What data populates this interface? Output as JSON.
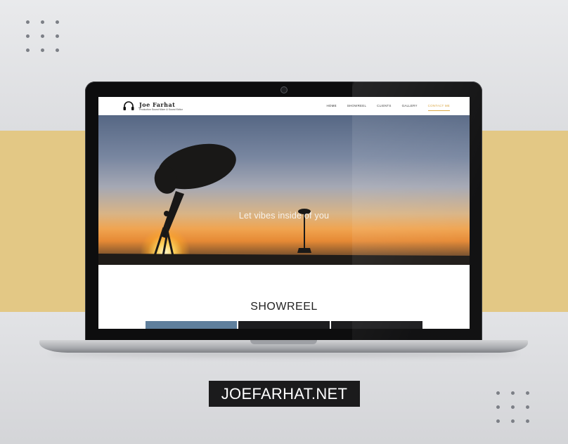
{
  "site": {
    "logo": {
      "name": "Joe Farhat",
      "subtitle": "Production Sound Mixer & Sound Editor"
    },
    "nav": [
      {
        "label": "HOME"
      },
      {
        "label": "SHOWREEL"
      },
      {
        "label": "CLIENTS"
      },
      {
        "label": "GALLERY"
      },
      {
        "label": "CONTACT ME",
        "active": true
      }
    ],
    "hero": {
      "tagline": "Let vibes inside of you"
    },
    "section": {
      "title": "SHOWREEL"
    }
  },
  "caption": "JOEFARHAT.NET",
  "colors": {
    "band": "#e3c885",
    "nav_active": "#d9a43d",
    "badge": "#1b1b1c"
  },
  "icons": [
    "headphones-logo-icon",
    "camera-icon"
  ]
}
